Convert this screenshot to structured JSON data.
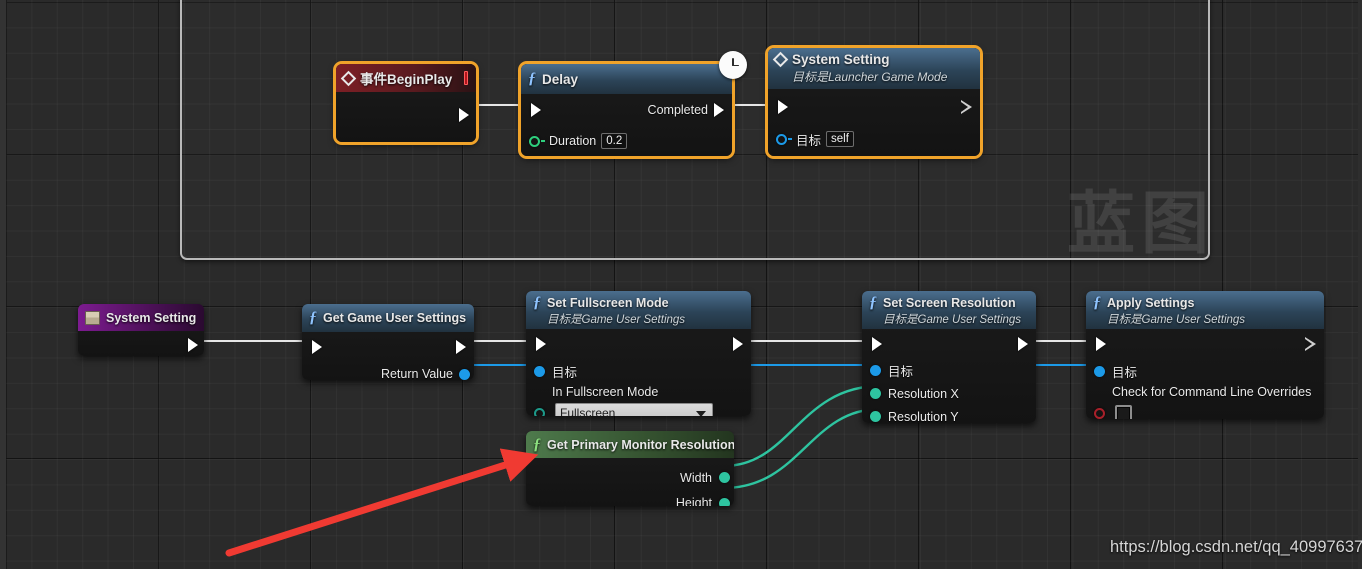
{
  "app": {
    "watermark_text": "蓝图",
    "url_watermark": "https://blog.csdn.net/qq_40997637"
  },
  "graph": {
    "top_region": {
      "name": "event-graph-region"
    },
    "nodes": [
      {
        "id": "event-begin-play",
        "title": "事件BeginPlay",
        "subtitle": "",
        "icon": "diamond-icon",
        "badge": "stop-square-icon",
        "selected": true,
        "kind": "event",
        "pins_out_exec": [
          ""
        ]
      },
      {
        "id": "delay",
        "title": "Delay",
        "subtitle": "",
        "icon": "fx-icon",
        "badge": "clock-icon",
        "selected": true,
        "kind": "function",
        "out_exec_label": "Completed",
        "input_label": "Duration",
        "input_value": "0.2"
      },
      {
        "id": "system-setting-event",
        "title": "System Setting",
        "subtitle": "目标是Launcher Game Mode",
        "icon": "diamond-icon",
        "selected": true,
        "kind": "function",
        "target_label": "目标",
        "target_value": "self"
      },
      {
        "id": "system-setting-var",
        "title": "System Setting",
        "subtitle": "",
        "icon": "book-icon",
        "selected": false,
        "kind": "variable"
      },
      {
        "id": "get-game-user-settings",
        "title": "Get Game User Settings",
        "subtitle": "",
        "icon": "fx-icon",
        "selected": false,
        "kind": "function",
        "return_label": "Return Value"
      },
      {
        "id": "set-fullscreen-mode",
        "title": "Set Fullscreen Mode",
        "subtitle": "目标是Game User Settings",
        "icon": "fx-icon",
        "selected": false,
        "kind": "function",
        "target_label": "目标",
        "enum_label": "In Fullscreen Mode",
        "enum_value": "Fullscreen"
      },
      {
        "id": "set-screen-resolution",
        "title": "Set Screen Resolution",
        "subtitle": "目标是Game User Settings",
        "icon": "fx-icon",
        "selected": false,
        "kind": "function",
        "target_label": "目标",
        "res_x_label": "Resolution X",
        "res_y_label": "Resolution Y"
      },
      {
        "id": "apply-settings",
        "title": "Apply Settings",
        "subtitle": "目标是Game User Settings",
        "icon": "fx-icon",
        "selected": false,
        "kind": "function",
        "target_label": "目标",
        "checkbox_label": "Check for Command Line Overrides",
        "checkbox_checked": false
      },
      {
        "id": "get-primary-monitor-resolution",
        "title": "Get Primary Monitor Resolution",
        "subtitle": "",
        "icon": "fx-icon",
        "selected": false,
        "kind": "pure",
        "width_label": "Width",
        "height_label": "Height"
      }
    ],
    "annotation": {
      "name": "red-arrow-annotation",
      "color": "#f03a32"
    }
  },
  "colors": {
    "exec_wire": "#e6e6e6",
    "object_wire": "#1c9ae8",
    "struct_wire": "#2ec4a0",
    "selection": "#f0a32a",
    "event_header": "#7d1f25",
    "function_header": "#2c4458",
    "variable_header": "#7d1b90",
    "pure_header": "#34512f"
  }
}
